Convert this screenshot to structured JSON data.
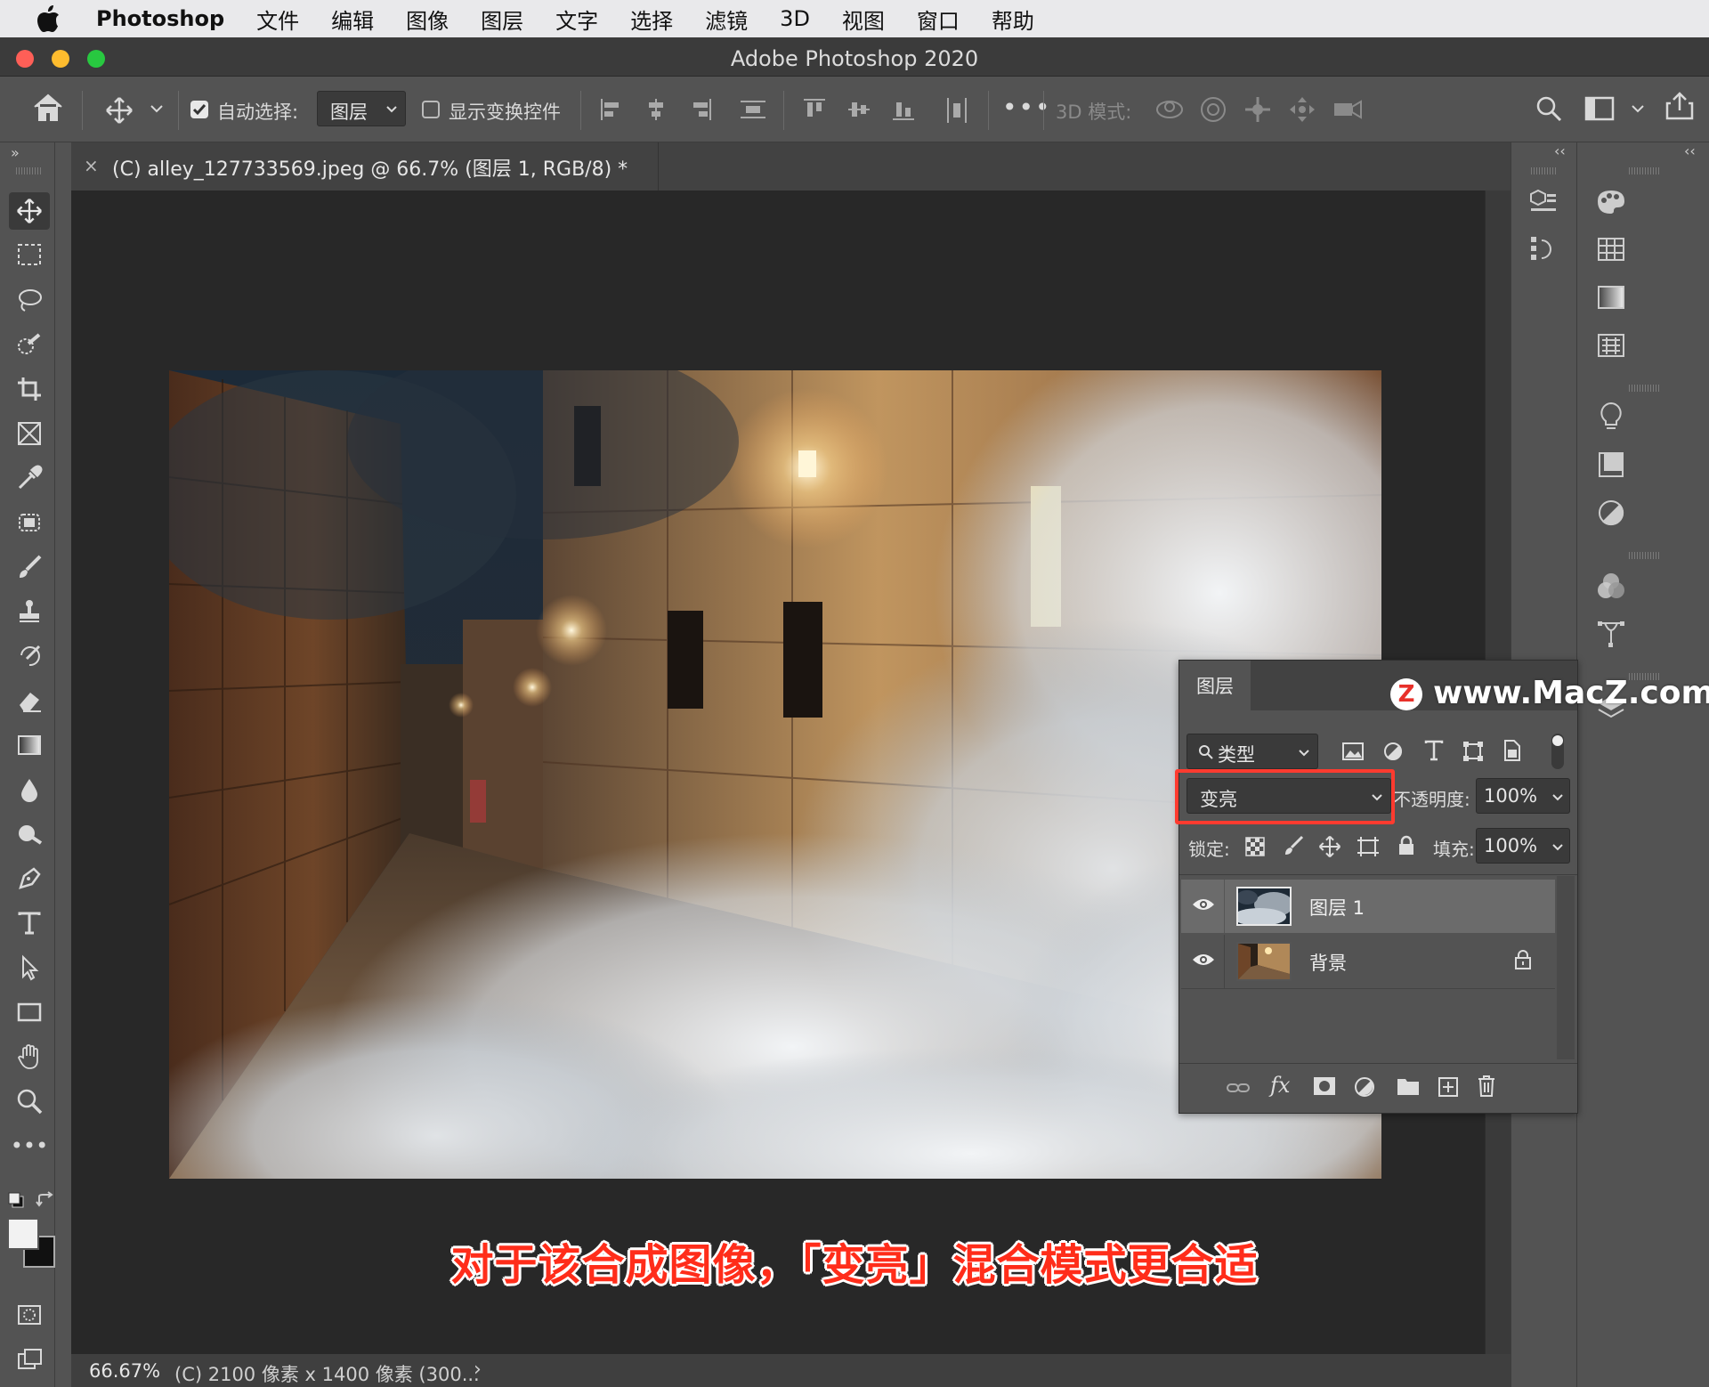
{
  "menubar": {
    "app": "Photoshop",
    "items": [
      "文件",
      "编辑",
      "图像",
      "图层",
      "文字",
      "选择",
      "滤镜",
      "3D",
      "视图",
      "窗口",
      "帮助"
    ]
  },
  "window": {
    "title": "Adobe Photoshop 2020"
  },
  "options": {
    "auto_select_label": "自动选择:",
    "auto_select_value": "图层",
    "show_transform_label": "显示变换控件",
    "mode_3d_label": "3D 模式:"
  },
  "document": {
    "tab_title": "(C) alley_127733569.jpeg @ 66.7% (图层 1, RGB/8) *",
    "zoom": "66.67%",
    "status": "(C) 2100 像素 x 1400 像素 (300... "
  },
  "layers_panel": {
    "tab": "图层",
    "filter_label": "类型",
    "blend_mode": "变亮",
    "opacity_label": "不透明度:",
    "opacity_value": "100%",
    "lock_label": "锁定:",
    "fill_label": "填充:",
    "fill_value": "100%",
    "layers": [
      {
        "name": "图层 1",
        "selected": true
      },
      {
        "name": "背景",
        "locked": true
      }
    ]
  },
  "caption": "对于该合成图像，「变亮」混合模式更合适",
  "watermark": {
    "logo": "Z",
    "text": "www.MacZ.com"
  },
  "colors": {
    "highlight_box": "#ff3b2f",
    "caption_text": "#ff2d1a",
    "traffic_close": "#fe5f57",
    "traffic_min": "#febc2e",
    "traffic_max": "#28c840"
  }
}
